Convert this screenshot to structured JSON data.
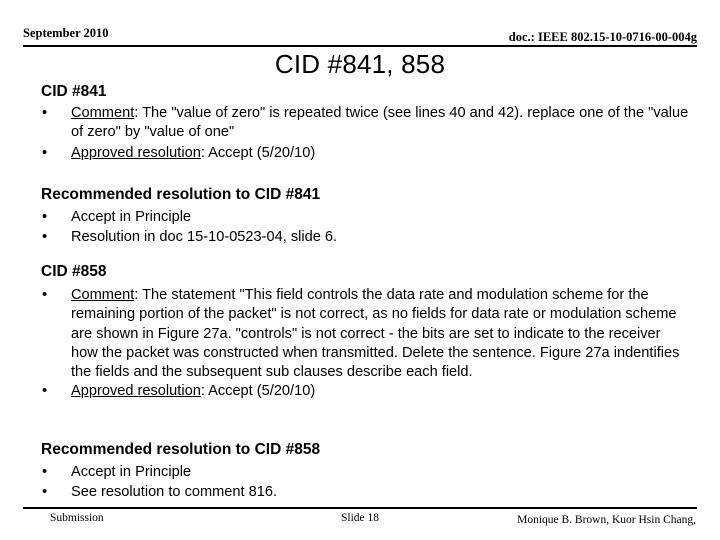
{
  "header": {
    "date": "September 2010",
    "doc_reference": "doc.: IEEE 802.15-10-0716-00-004g"
  },
  "title": "CID #841, 858",
  "sections": [
    {
      "heading": "CID #841",
      "bullets": [
        {
          "label": "Comment",
          "label_underlined": true,
          "text": ": The \"value of zero\" is repeated twice (see lines 40 and 42). replace one of the \"value of zero\" by \"value of one\""
        },
        {
          "label": "Approved resolution",
          "label_underlined": true,
          "text": ": Accept (5/20/10)"
        }
      ]
    },
    {
      "heading": "Recommended resolution to CID #841",
      "bullets": [
        {
          "label": "",
          "label_underlined": false,
          "text": "Accept in Principle"
        },
        {
          "label": "",
          "label_underlined": false,
          "text": "Resolution in doc 15-10-0523-04, slide 6."
        }
      ]
    },
    {
      "heading": "CID #858",
      "bullets": [
        {
          "label": "Comment",
          "label_underlined": true,
          "text": ": The statement \"This field controls the data rate and modulation scheme for the remaining portion of the packet\" is not correct, as no fields for data rate or modulation scheme are shown in Figure 27a.  \"controls\" is not correct - the bits are set to indicate to the receiver how the packet was constructed when transmitted. Delete the sentence. Figure 27a indentifies the fields and the subsequent sub clauses describe each field."
        },
        {
          "label": "Approved resolution",
          "label_underlined": true,
          "text": ": Accept (5/20/10)"
        }
      ]
    },
    {
      "heading": "Recommended resolution to CID #858",
      "bullets": [
        {
          "label": "",
          "label_underlined": false,
          "text": "Accept in Principle"
        },
        {
          "label": "",
          "label_underlined": false,
          "text": "See resolution to comment 816."
        }
      ]
    }
  ],
  "bullet_glyph": "•",
  "footer": {
    "left": "Submission",
    "center": "Slide 18",
    "right": "Monique B. Brown, Kuor Hsin Chang,"
  }
}
